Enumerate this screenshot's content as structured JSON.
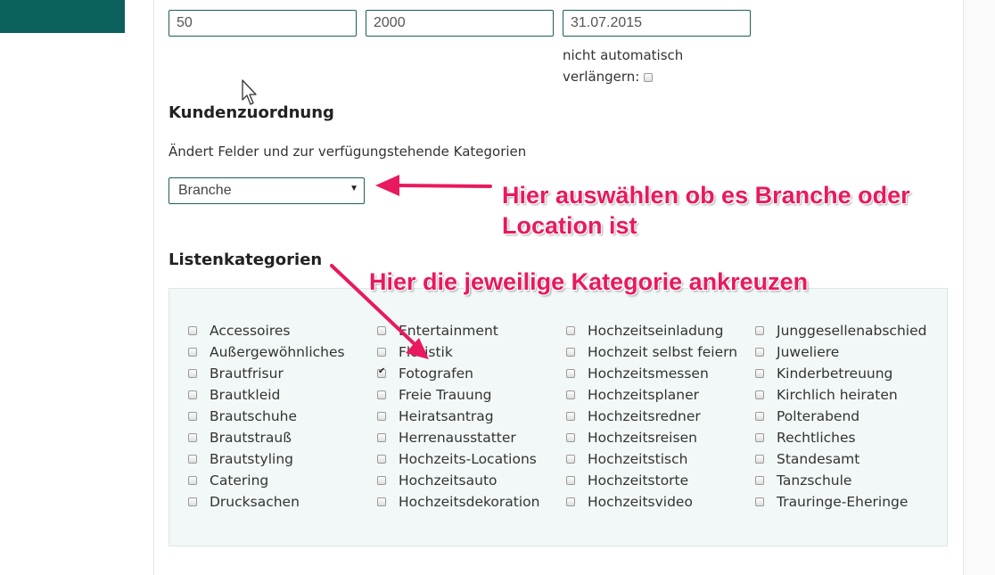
{
  "fields": {
    "field1_value": "50",
    "field2_value": "2000",
    "field3_value": "31.07.2015"
  },
  "auto_renew": {
    "line1": "nicht automatisch",
    "line2": "verlängern:"
  },
  "assignment": {
    "heading": "Kundenzuordnung",
    "description": "Ändert Felder und zur verfügungstehende Kategorien",
    "select_value": "Branche"
  },
  "categories": {
    "heading": "Listenkategorien",
    "columns": [
      [
        {
          "label": "Accessoires",
          "checked": false
        },
        {
          "label": "Außergewöhnliches",
          "checked": false
        },
        {
          "label": "Brautfrisur",
          "checked": false
        },
        {
          "label": "Brautkleid",
          "checked": false
        },
        {
          "label": "Brautschuhe",
          "checked": false
        },
        {
          "label": "Brautstrauß",
          "checked": false
        },
        {
          "label": "Brautstyling",
          "checked": false
        },
        {
          "label": "Catering",
          "checked": false
        },
        {
          "label": "Drucksachen",
          "checked": false
        }
      ],
      [
        {
          "label": "Entertainment",
          "checked": false
        },
        {
          "label": "Floristik",
          "checked": false
        },
        {
          "label": "Fotografen",
          "checked": true
        },
        {
          "label": "Freie Trauung",
          "checked": false
        },
        {
          "label": "Heiratsantrag",
          "checked": false
        },
        {
          "label": "Herrenausstatter",
          "checked": false
        },
        {
          "label": "Hochzeits-Locations",
          "checked": false
        },
        {
          "label": "Hochzeitsauto",
          "checked": false
        },
        {
          "label": "Hochzeitsdekoration",
          "checked": false
        }
      ],
      [
        {
          "label": "Hochzeitseinladung",
          "checked": false
        },
        {
          "label": "Hochzeit selbst feiern",
          "checked": false
        },
        {
          "label": "Hochzeitsmessen",
          "checked": false
        },
        {
          "label": "Hochzeitsplaner",
          "checked": false
        },
        {
          "label": "Hochzeitsredner",
          "checked": false
        },
        {
          "label": "Hochzeitsreisen",
          "checked": false
        },
        {
          "label": "Hochzeitstisch",
          "checked": false
        },
        {
          "label": "Hochzeitstorte",
          "checked": false
        },
        {
          "label": "Hochzeitsvideo",
          "checked": false
        }
      ],
      [
        {
          "label": "Junggesellenabschied",
          "checked": false
        },
        {
          "label": "Juweliere",
          "checked": false
        },
        {
          "label": "Kinderbetreuung",
          "checked": false
        },
        {
          "label": "Kirchlich heiraten",
          "checked": false
        },
        {
          "label": "Polterabend",
          "checked": false
        },
        {
          "label": "Rechtliches",
          "checked": false
        },
        {
          "label": "Standesamt",
          "checked": false
        },
        {
          "label": "Tanzschule",
          "checked": false
        },
        {
          "label": "Trauringe-Eheringe",
          "checked": false
        }
      ]
    ]
  },
  "annotations": {
    "select_note_line1": "Hier auswählen ob es Branche oder",
    "select_note_line2": "Location ist",
    "category_note": "Hier die jeweilige Kategorie ankreuzen",
    "color": "#e8195f"
  },
  "colors": {
    "brand_teal": "#0b5f5d",
    "panel_bg": "#f2f8f7"
  }
}
